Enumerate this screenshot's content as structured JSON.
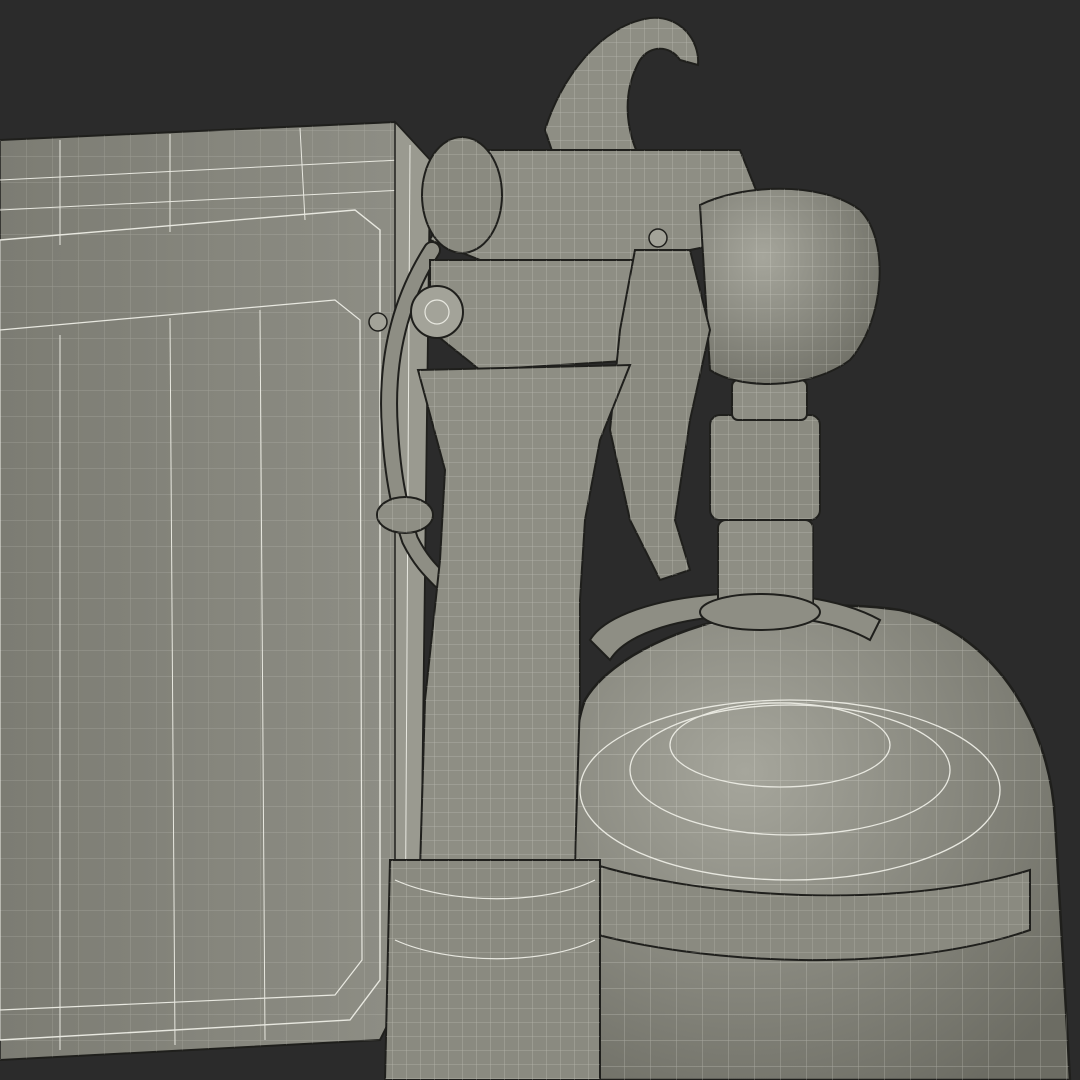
{
  "scene": {
    "subject": "spray-gun-wireframe-render",
    "colors": {
      "background": "#2b2b2b",
      "surface": "#8e8e84",
      "surface_light": "#a3a399",
      "surface_dark": "#6f6f66",
      "wire": "#e8e8e0",
      "edge": "#1f1f1c"
    }
  }
}
